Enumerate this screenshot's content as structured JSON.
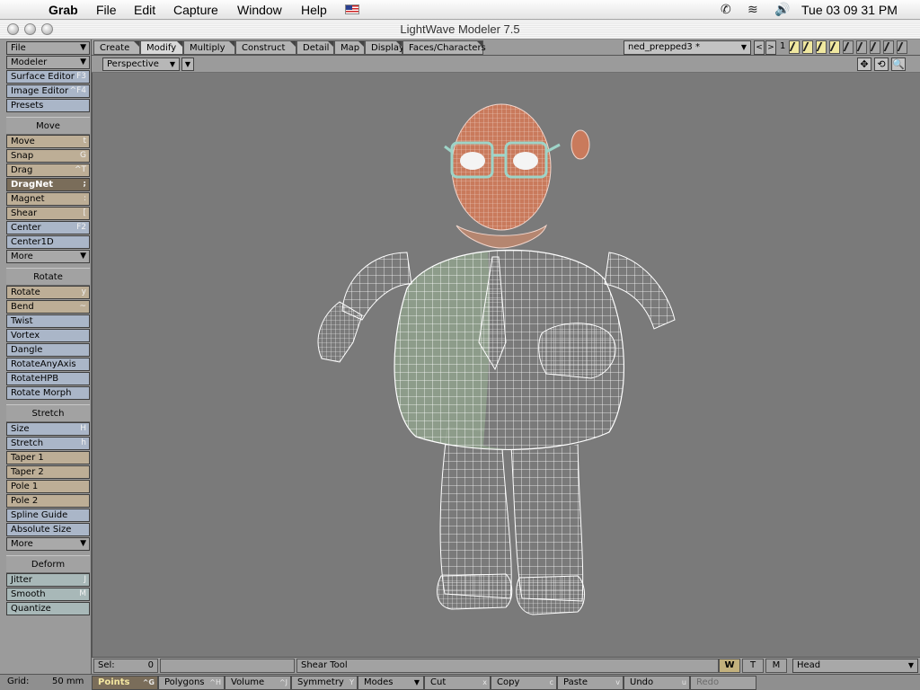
{
  "menubar": {
    "apple_icon": "apple-icon",
    "items": [
      "Grab",
      "File",
      "Edit",
      "Capture",
      "Window",
      "Help"
    ],
    "status_icons": [
      "phone-icon",
      "wifi-icon",
      "volume-icon"
    ],
    "clock": "Tue 03 09 31 PM"
  },
  "window": {
    "title": "LightWave Modeler 7.5"
  },
  "toolpanel": {
    "top": [
      {
        "label": "File",
        "arrow": "▼"
      },
      {
        "label": "Modeler",
        "arrow": "▼"
      },
      {
        "label": "Surface Editor",
        "key": "F3"
      },
      {
        "label": "Image Editor",
        "key": "^F4"
      },
      {
        "label": "Presets",
        "key": ""
      }
    ],
    "sections": {
      "move": "Move",
      "rotate": "Rotate",
      "stretch": "Stretch",
      "deform": "Deform"
    },
    "move": [
      {
        "label": "Move",
        "key": "t"
      },
      {
        "label": "Snap",
        "key": "G"
      },
      {
        "label": "Drag",
        "key": "^T"
      },
      {
        "label": "DragNet",
        "key": ";"
      },
      {
        "label": "Magnet",
        "key": ":"
      },
      {
        "label": "Shear",
        "key": "["
      },
      {
        "label": "Center",
        "key": "F2"
      },
      {
        "label": "Center1D",
        "key": ""
      },
      {
        "label": "More",
        "arrow": "▼"
      }
    ],
    "rotate": [
      {
        "label": "Rotate",
        "key": "y"
      },
      {
        "label": "Bend",
        "key": "~"
      },
      {
        "label": "Twist",
        "key": ""
      },
      {
        "label": "Vortex",
        "key": ""
      },
      {
        "label": "Dangle",
        "key": ""
      },
      {
        "label": "RotateAnyAxis",
        "key": ""
      },
      {
        "label": "RotateHPB",
        "key": ""
      },
      {
        "label": "Rotate Morph",
        "key": ""
      }
    ],
    "stretch": [
      {
        "label": "Size",
        "key": "H"
      },
      {
        "label": "Stretch",
        "key": "h"
      },
      {
        "label": "Taper 1",
        "key": ""
      },
      {
        "label": "Taper 2",
        "key": ""
      },
      {
        "label": "Pole 1",
        "key": ""
      },
      {
        "label": "Pole 2",
        "key": ""
      },
      {
        "label": "Spline Guide",
        "key": ""
      },
      {
        "label": "Absolute Size",
        "key": ""
      },
      {
        "label": "More",
        "arrow": "▼"
      }
    ],
    "deform": [
      {
        "label": "Jitter",
        "key": "J"
      },
      {
        "label": "Smooth",
        "key": "M"
      },
      {
        "label": "Quantize",
        "key": ""
      }
    ]
  },
  "tabs": [
    "Create",
    "Modify",
    "Multiply",
    "Construct",
    "Detail",
    "Map",
    "Display",
    "Faces/Characters"
  ],
  "active_tab": "Modify",
  "object_select": {
    "value": "ned_prepped3 *",
    "arrow": "▼"
  },
  "nav": {
    "prev": "<",
    "next": ">"
  },
  "layer_number": "1",
  "layers": {
    "on_count": 4,
    "off_count": 5
  },
  "viewport": {
    "view_mode": "Perspective",
    "arrow": "▼",
    "icons": [
      "move-view-icon",
      "rotate-view-icon",
      "zoom-icon"
    ],
    "icon_glyphs": [
      "✥",
      "⟲",
      "🔍"
    ]
  },
  "statusbar": {
    "sel_label": "Sel:",
    "sel_value": "0",
    "tool": "Shear Tool",
    "wtm": [
      "W",
      "T",
      "M"
    ],
    "wtm_active": "W",
    "surface": "Head",
    "arrow": "▼"
  },
  "modebar": {
    "grid_label": "Grid:",
    "grid_value": "50 mm",
    "buttons": [
      {
        "label": "Points",
        "key": "^G"
      },
      {
        "label": "Polygons",
        "key": "^H"
      },
      {
        "label": "Volume",
        "key": "^J"
      },
      {
        "label": "Symmetry",
        "key": "Y"
      },
      {
        "label": "Modes",
        "arrow": "▼"
      },
      {
        "label": "Cut",
        "key": "x"
      },
      {
        "label": "Copy",
        "key": "c"
      },
      {
        "label": "Paste",
        "key": "v"
      },
      {
        "label": "Undo",
        "key": "u"
      },
      {
        "label": "Redo",
        "key": ""
      }
    ],
    "active": "Points"
  },
  "colors": {
    "head_mesh": "#c97a5c",
    "body_mesh": "#8fa08c",
    "wire": "#ffffff",
    "glasses": "#9ed4c8"
  }
}
